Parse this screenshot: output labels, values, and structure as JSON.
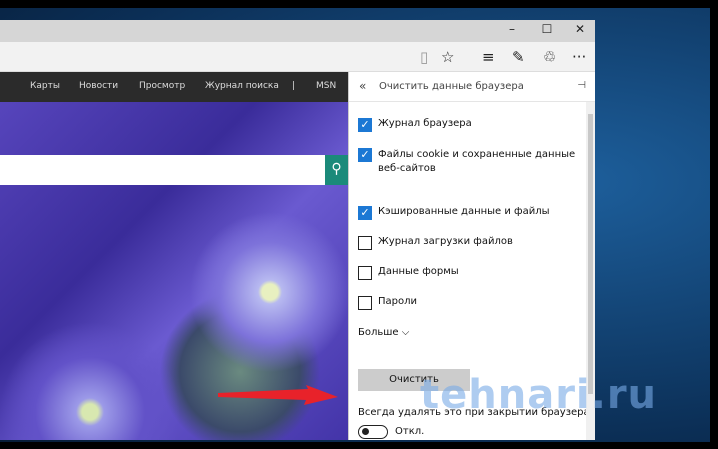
{
  "window": {
    "minimize": "–",
    "maximize": "☐",
    "close": "✕"
  },
  "toolbar": {
    "reading": "▯",
    "favorite": "☆",
    "hub": "≡",
    "note": "✎",
    "share": "♲",
    "more": "···"
  },
  "nav": [
    "Карты",
    "Новости",
    "Просмотр",
    "Журнал поиска",
    "|",
    "MSN"
  ],
  "panel": {
    "back": "«",
    "title": "Очистить данные браузера",
    "pin": "⊣",
    "options": [
      {
        "label": "Журнал браузера",
        "checked": true
      },
      {
        "label": "Файлы cookie и сохраненные данные веб-сайтов",
        "checked": true
      },
      {
        "label": "Кэшированные данные и файлы",
        "checked": true
      },
      {
        "label": "Журнал загрузки файлов",
        "checked": false
      },
      {
        "label": "Данные формы",
        "checked": false
      },
      {
        "label": "Пароли",
        "checked": false
      }
    ],
    "more": "Больше ⌵",
    "clear": "Очистить",
    "always": "Всегда удалять это при закрытии браузера",
    "toggle": "Откл."
  },
  "watermark": "tehnari.ru",
  "accent": "#1c78d4"
}
